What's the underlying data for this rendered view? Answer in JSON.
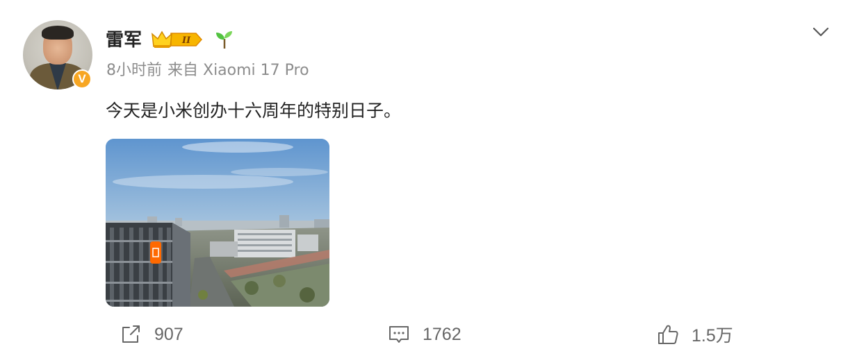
{
  "post": {
    "username": "雷军",
    "verified_badge": "V",
    "level_badge": "II",
    "time": "8小时前",
    "source": "来自 Xiaomi 17 Pro",
    "text": "今天是小米创办十六周年的特别日子。"
  },
  "actions": {
    "repost_count": "907",
    "comment_count": "1762",
    "like_count": "1.5万"
  },
  "icons": [
    "avatar",
    "crown-level-icon",
    "sprout-icon",
    "chevron-down-icon",
    "repost-icon",
    "comment-icon",
    "like-icon"
  ],
  "colors": {
    "verified": "#f7a623",
    "meta_text": "#8c8c8c",
    "action_text": "#666666",
    "xiaomi_orange": "#ff6900"
  }
}
